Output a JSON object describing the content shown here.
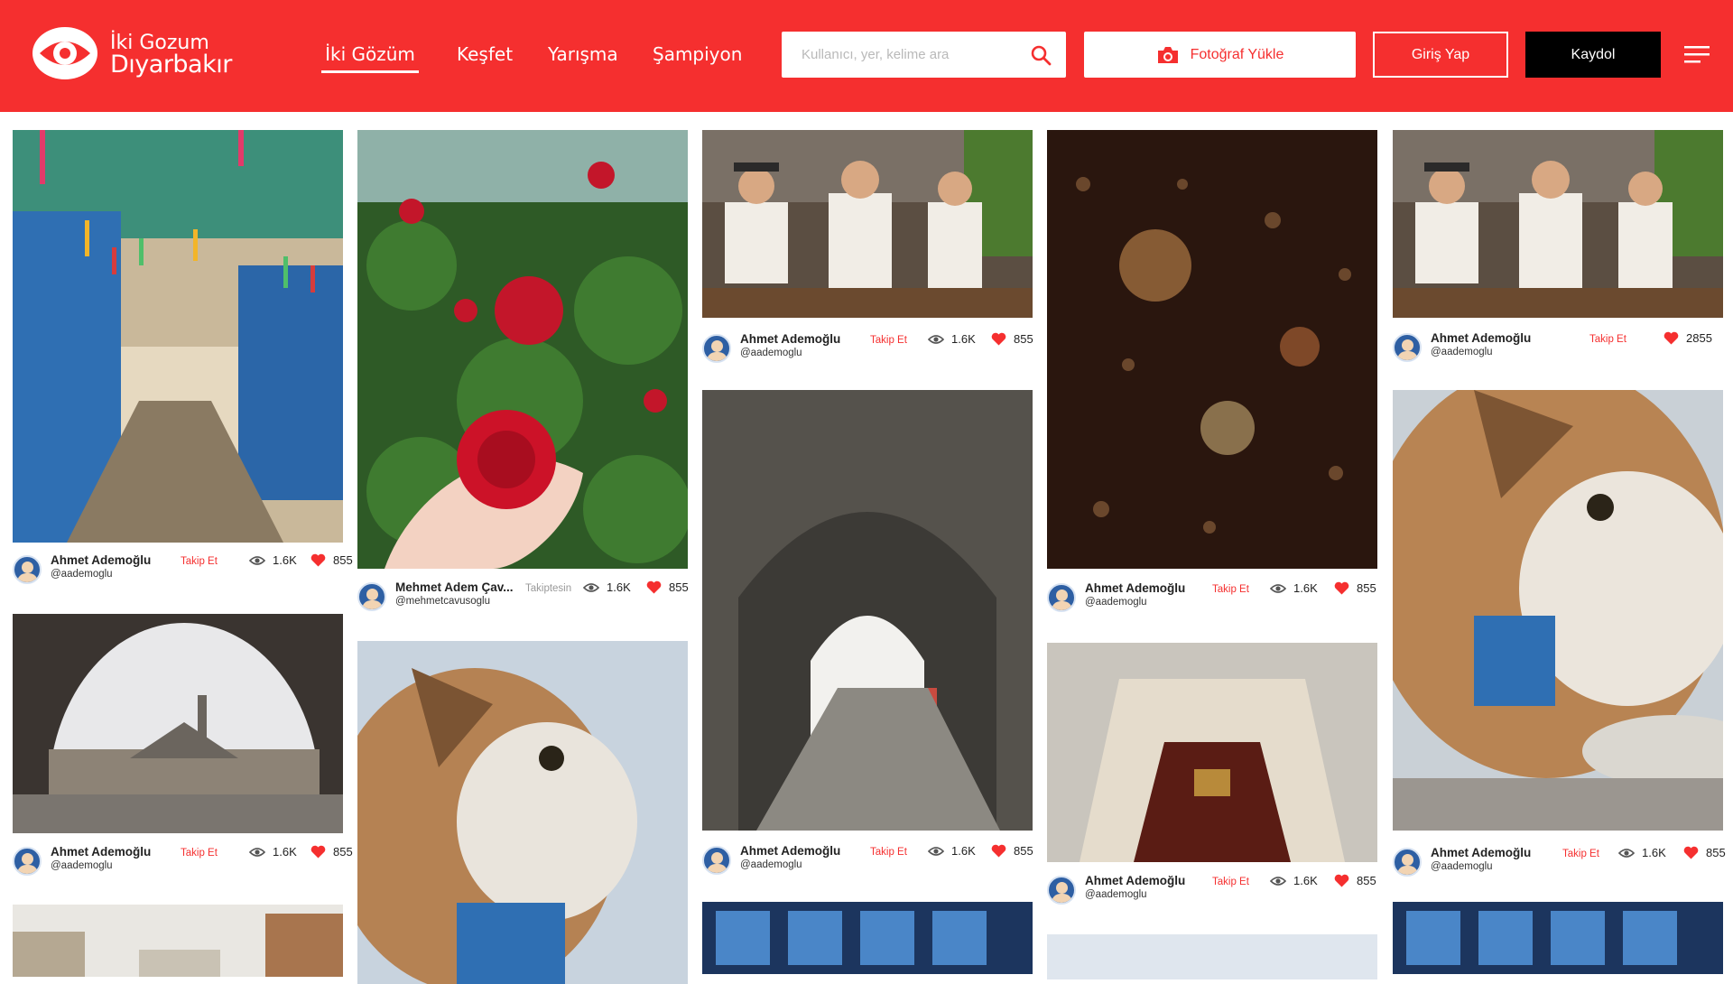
{
  "header": {
    "logo_line1": "İki Gozum",
    "logo_line2": "Dıyarbakır",
    "nav": [
      "İki Gözüm",
      "Keşfet",
      "Yarışma",
      "Şampiyon"
    ],
    "search_placeholder": "Kullanıcı, yer, kelime ara",
    "upload_label": "Fotoğraf Yükle",
    "login_label": "Giriş Yap",
    "signup_label": "Kaydol"
  },
  "colors": {
    "brand": "#f52f2f",
    "signup": "#000000"
  },
  "cards": [
    {
      "user": "Ahmet Ademoğlu",
      "handle": "@aademoglu",
      "follow": "Takip Et",
      "views": "1.6K",
      "likes": "855",
      "photo": "colorful-alley"
    },
    {
      "user": "Ahmet Ademoğlu",
      "handle": "@aademoglu",
      "follow": "Takip Et",
      "views": "1.6K",
      "likes": "855",
      "photo": "mosque-arch"
    },
    {
      "user": "",
      "handle": "",
      "follow": "",
      "views": "",
      "likes": "",
      "photo": "street"
    },
    {
      "user": "Mehmet Adem Çav...",
      "handle": "@mehmetcavusoglu",
      "follow": "Takiptesin",
      "views": "1.6K",
      "likes": "855",
      "photo": "red-rose"
    },
    {
      "user": "",
      "handle": "",
      "follow": "",
      "views": "",
      "likes": "",
      "photo": "cat"
    },
    {
      "user": "Ahmet Ademoğlu",
      "handle": "@aademoglu",
      "follow": "Takip Et",
      "views": "1.6K",
      "likes": "855",
      "photo": "old-men"
    },
    {
      "user": "Ahmet Ademoğlu",
      "handle": "@aademoglu",
      "follow": "Takip Et",
      "views": "1.6K",
      "likes": "855",
      "photo": "stone-arch"
    },
    {
      "user": "",
      "handle": "",
      "follow": "",
      "views": "",
      "likes": "",
      "photo": "window-grid"
    },
    {
      "user": "Ahmet Ademoğlu",
      "handle": "@aademoglu",
      "follow": "Takip Et",
      "views": "1.6K",
      "likes": "855",
      "photo": "rain-drops"
    },
    {
      "user": "Ahmet Ademoğlu",
      "handle": "@aademoglu",
      "follow": "Takip Et",
      "views": "1.6K",
      "likes": "855",
      "photo": "ceiling"
    },
    {
      "user": "",
      "handle": "",
      "follow": "",
      "views": "",
      "likes": "",
      "photo": "sky"
    },
    {
      "user": "Ahmet Ademoğlu",
      "handle": "@aademoglu",
      "follow": "Takip Et",
      "views": "",
      "likes": "2855",
      "photo": "old-men"
    },
    {
      "user": "Ahmet Ademoğlu",
      "handle": "@aademoglu",
      "follow": "Takip Et",
      "views": "1.6K",
      "likes": "855",
      "photo": "cat-bowl"
    },
    {
      "user": "",
      "handle": "",
      "follow": "",
      "views": "",
      "likes": "",
      "photo": "window-grid"
    }
  ]
}
